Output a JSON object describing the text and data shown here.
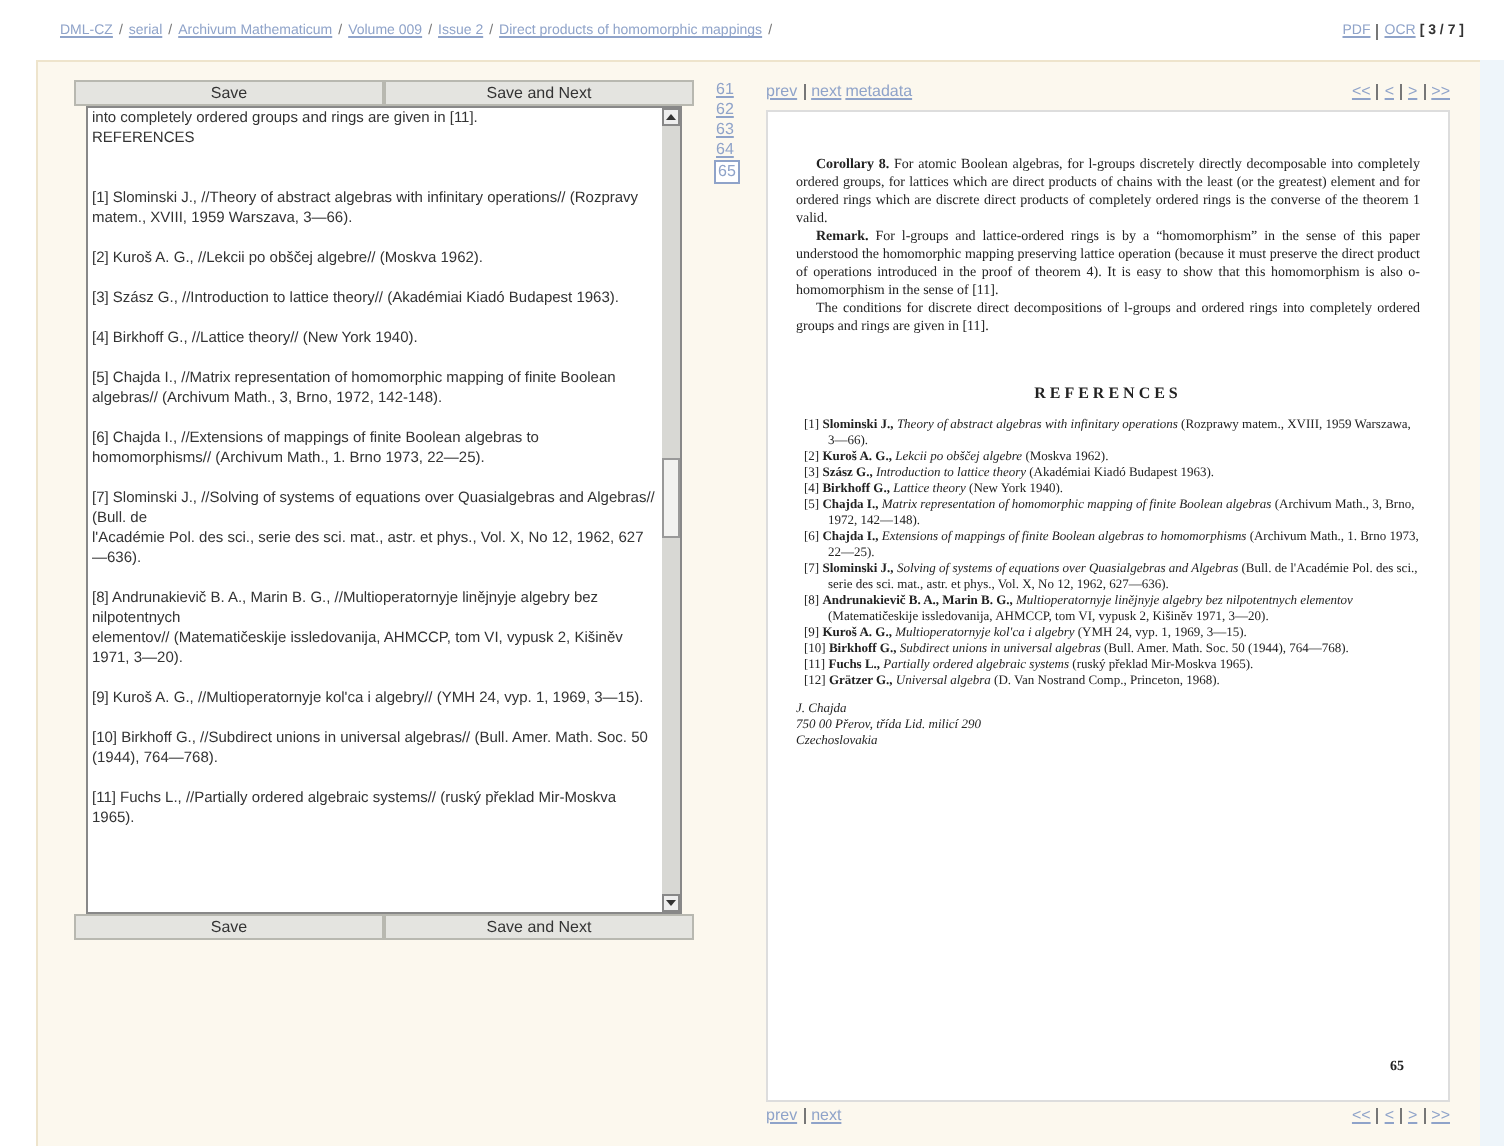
{
  "breadcrumb": [
    "DML-CZ",
    "serial",
    "Archivum Mathematicum",
    "Volume 009",
    "Issue 2",
    "Direct products of homomorphic mappings"
  ],
  "breadcrumb_separator": "/",
  "top_links": {
    "pdf": "PDF",
    "ocr": "OCR",
    "page_counter": "[ 3 / 7 ]"
  },
  "editor": {
    "top_buttons": [
      "Save",
      "Save and Next"
    ],
    "bottom_buttons": [
      "Save",
      "Save and Next"
    ],
    "text": "into completely ordered groups and rings are given in [11].\nREFERENCES\n\n\n[1] Slominski J., //Theory of abstract algebras with infinitary operations// (Rozpravy matem., XVIII, 1959 Warszava, 3—66).\n\n[2] Kuroš A. G., //Lekcii po obščej algebre// (Moskva 1962).\n\n[3] Szász G., //Introduction to lattice theory// (Akadémiai Kiadó Budapest 1963).\n\n[4] Birkhoff G., //Lattice theory// (New York 1940).\n\n[5] Chajda I., //Matrix representation of homomorphic mapping of finite Boolean algebras// (Archivum Math., 3, Brno, 1972, 142-148).\n\n[6] Chajda I., //Extensions of mappings of finite Boolean algebras to homomorphisms// (Archivum Math., 1. Brno 1973, 22—25).\n\n[7] Slominski J., //Solving of systems of equations over Quasialgebras and Algebras// (Bull. de\nl'Académie Pol. des sci., serie des sci. mat., astr. et phys., Vol. X, No 12, 1962, 627—636).\n\n[8] Andrunakievič B. A., Marin B. G., //Multioperatornyje linějnyje algebry bez nilpotentnych\nelementov// (Matematičeskije issledovanija, AHMCCP, tom VI, vypusk 2, Kišiněv 1971, 3—20).\n\n[9] Kuroš A. G., //Multioperatornyje kol'ca i algebry// (YMH 24, vyp. 1, 1969, 3—15).\n\n[10] Birkhoff G., //Subdirect unions in universal algebras// (Bull. Amer. Math. Soc. 50 (1944), 764—768).\n\n[11] Fuchs L., //Partially ordered algebraic systems// (ruský překlad Mir-Moskva 1965)."
  },
  "pages": [
    {
      "label": "61",
      "selected": false
    },
    {
      "label": "62",
      "selected": false
    },
    {
      "label": "63",
      "selected": false
    },
    {
      "label": "64",
      "selected": false
    },
    {
      "label": "65",
      "selected": true
    }
  ],
  "viewer_top": {
    "prev": "prev",
    "next": "next",
    "metadata": "metadata",
    "nav": [
      "<<",
      "<",
      ">",
      ">>"
    ]
  },
  "viewer_bottom": {
    "prev": "prev",
    "next": "next",
    "nav": [
      "<<",
      "<",
      ">",
      ">>"
    ]
  },
  "document": {
    "paragraphs": [
      {
        "lead": "Corollary 8.",
        "text": "For atomic Boolean algebras, for l-groups discretely directly decomposable into completely ordered groups, for lattices which are direct products of chains with the least (or the greatest) element and for ordered rings which are discrete direct products of completely ordered rings is the converse of the theorem 1 valid."
      },
      {
        "lead": "Remark.",
        "text": "For l-groups and lattice-ordered rings is by a “homomorphism” in the sense of this paper understood the homomorphic mapping preserving lattice operation (because it must preserve the direct product of operations introduced in the proof of theorem 4). It is easy to show that this homomorphism is also o-homomorphism in the sense of [11]."
      },
      {
        "text": "The conditions for discrete direct decompositions of l-groups and ordered rings into completely ordered groups and rings are given in [11]."
      }
    ],
    "references_title": "REFERENCES",
    "references": [
      {
        "number": "[1]",
        "author": "Slominski J.,",
        "title": "Theory of abstract algebras with infinitary operations",
        "rest": "(Rozprawy matem., XVIII, 1959 Warszawa, 3—66)."
      },
      {
        "number": "[2]",
        "author": "Kuroš A. G.,",
        "title": "Lekcii po obščej algebre",
        "rest": "(Moskva 1962)."
      },
      {
        "number": "[3]",
        "author": "Szász G.,",
        "title": "Introduction to lattice theory",
        "rest": "(Akadémiai Kiadó Budapest 1963)."
      },
      {
        "number": "[4]",
        "author": "Birkhoff G.,",
        "title": "Lattice theory",
        "rest": "(New York 1940)."
      },
      {
        "number": "[5]",
        "author": "Chajda I.,",
        "title": "Matrix representation of homomorphic mapping of finite Boolean algebras",
        "rest": "(Archivum Math., 3, Brno, 1972, 142—148)."
      },
      {
        "number": "[6]",
        "author": "Chajda I.,",
        "title": "Extensions of mappings of finite Boolean algebras to homomorphisms",
        "rest": "(Archivum Math., 1. Brno 1973, 22—25)."
      },
      {
        "number": "[7]",
        "author": "Slominski J.,",
        "title": "Solving of systems of equations over Quasialgebras and Algebras",
        "rest": "(Bull. de l'Académie Pol. des sci., serie des sci. mat., astr. et phys., Vol. X, No 12, 1962, 627—636)."
      },
      {
        "number": "[8]",
        "author": "Andrunakievič B. A., Marin B. G.,",
        "title": "Multioperatornyje linějnyje algebry bez nilpotentnych elementov",
        "rest": "(Matematičeskije issledovanija, AHMCCP, tom VI, vypusk 2, Kišiněv 1971, 3—20)."
      },
      {
        "number": "[9]",
        "author": "Kuroš A. G.,",
        "title": "Multioperatornyje kol'ca i algebry",
        "rest": "(YMH 24, vyp. 1, 1969, 3—15)."
      },
      {
        "number": "[10]",
        "author": "Birkhoff G.,",
        "title": "Subdirect unions in universal algebras",
        "rest": "(Bull. Amer. Math. Soc. 50 (1944), 764—768)."
      },
      {
        "number": "[11]",
        "author": "Fuchs L.,",
        "title": "Partially ordered algebraic systems",
        "rest": "(ruský překlad Mir-Moskva 1965)."
      },
      {
        "number": "[12]",
        "author": "Grätzer G.,",
        "title": "Universal algebra",
        "rest": "(D. Van Nostrand Comp., Princeton, 1968)."
      }
    ],
    "address": [
      "J. Chajda",
      "750 00 Přerov, třída Lid. milicí 290",
      "Czechoslovakia"
    ],
    "page_number": "65"
  }
}
